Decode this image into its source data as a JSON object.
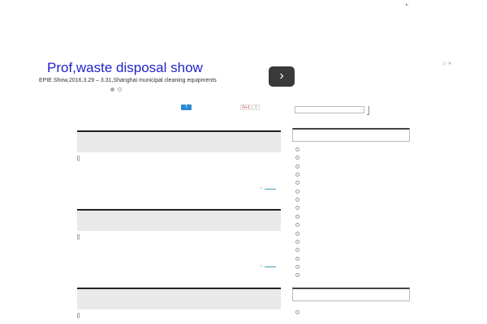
{
  "ad": {
    "title": "Prof,waste disposal show",
    "subtitle": "EPIE Show,2016.3.29 – 3.31,Shanghai municipal cleaning equipments",
    "next_label": "›",
    "close_label": "▷✕"
  },
  "top_mark": "▸.",
  "social": {
    "twitter": "t",
    "gplus": "G+1",
    "gplus_count": "0"
  },
  "posts": [
    {
      "meta": "[]"
    },
    {
      "meta": "[]"
    },
    {
      "meta": "[]"
    }
  ],
  "sidebar": {
    "item_count": 16,
    "second_item_count": 1
  }
}
